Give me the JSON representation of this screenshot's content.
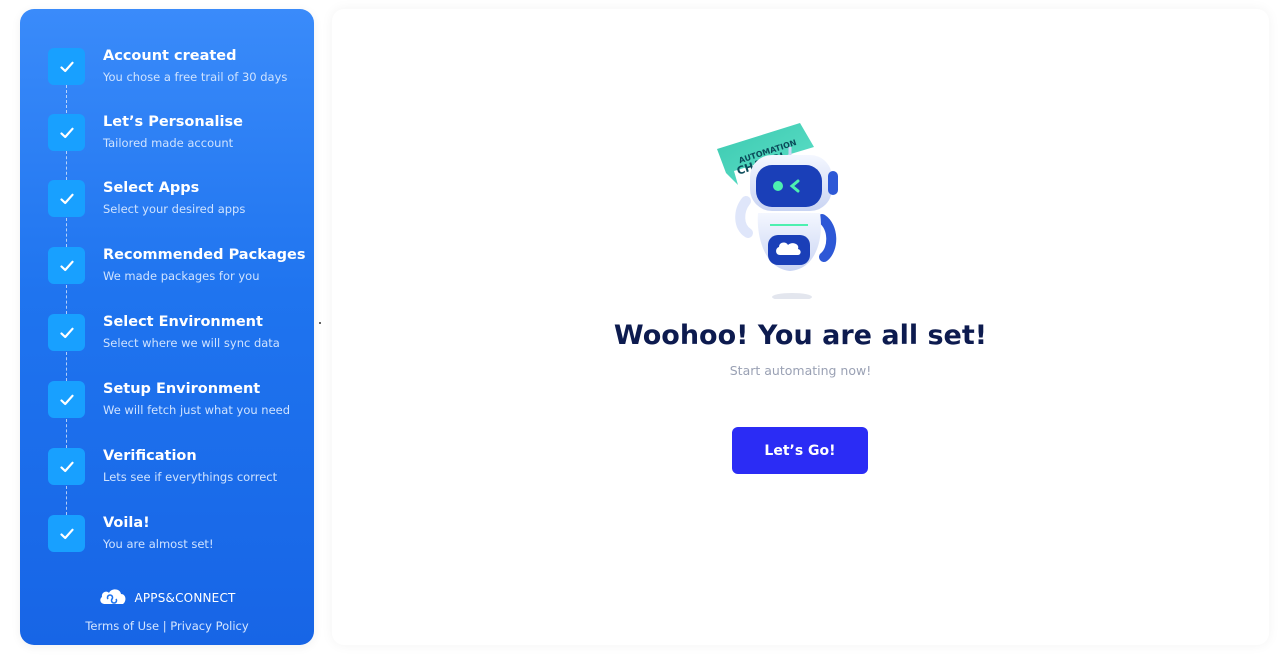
{
  "sidebar": {
    "steps": [
      {
        "title": "Account created",
        "subtitle": "You chose a free trail of 30 days"
      },
      {
        "title": "Let’s Personalise",
        "subtitle": "Tailored made account"
      },
      {
        "title": "Select Apps",
        "subtitle": "Select your desired apps"
      },
      {
        "title": "Recommended Packages",
        "subtitle": "We made packages for you"
      },
      {
        "title": "Select Environment",
        "subtitle": "Select where we will sync data"
      },
      {
        "title": "Setup Environment",
        "subtitle": "We will fetch just what you need"
      },
      {
        "title": "Verification",
        "subtitle": "Lets see if everythings correct"
      },
      {
        "title": "Voila!",
        "subtitle": "You are almost set!"
      }
    ],
    "brand": {
      "name": "APPS&CONNECT",
      "icon": "cloud-logo-icon"
    },
    "footer": {
      "terms": "Terms of Use",
      "separator": "|",
      "privacy": "Privacy Policy"
    }
  },
  "main": {
    "illustration": {
      "badge_text": "AUTOMATION CHAMP!"
    },
    "headline": "Woohoo! You are all set!",
    "subline": "Start automating now!",
    "cta_label": "Let’s Go!"
  },
  "colors": {
    "sidebar_top": "#3a8bfa",
    "sidebar_bottom": "#1765e6",
    "check_bg": "#18a0ff",
    "headline": "#0d1b4f",
    "cta_bg": "#2b2cf5"
  }
}
